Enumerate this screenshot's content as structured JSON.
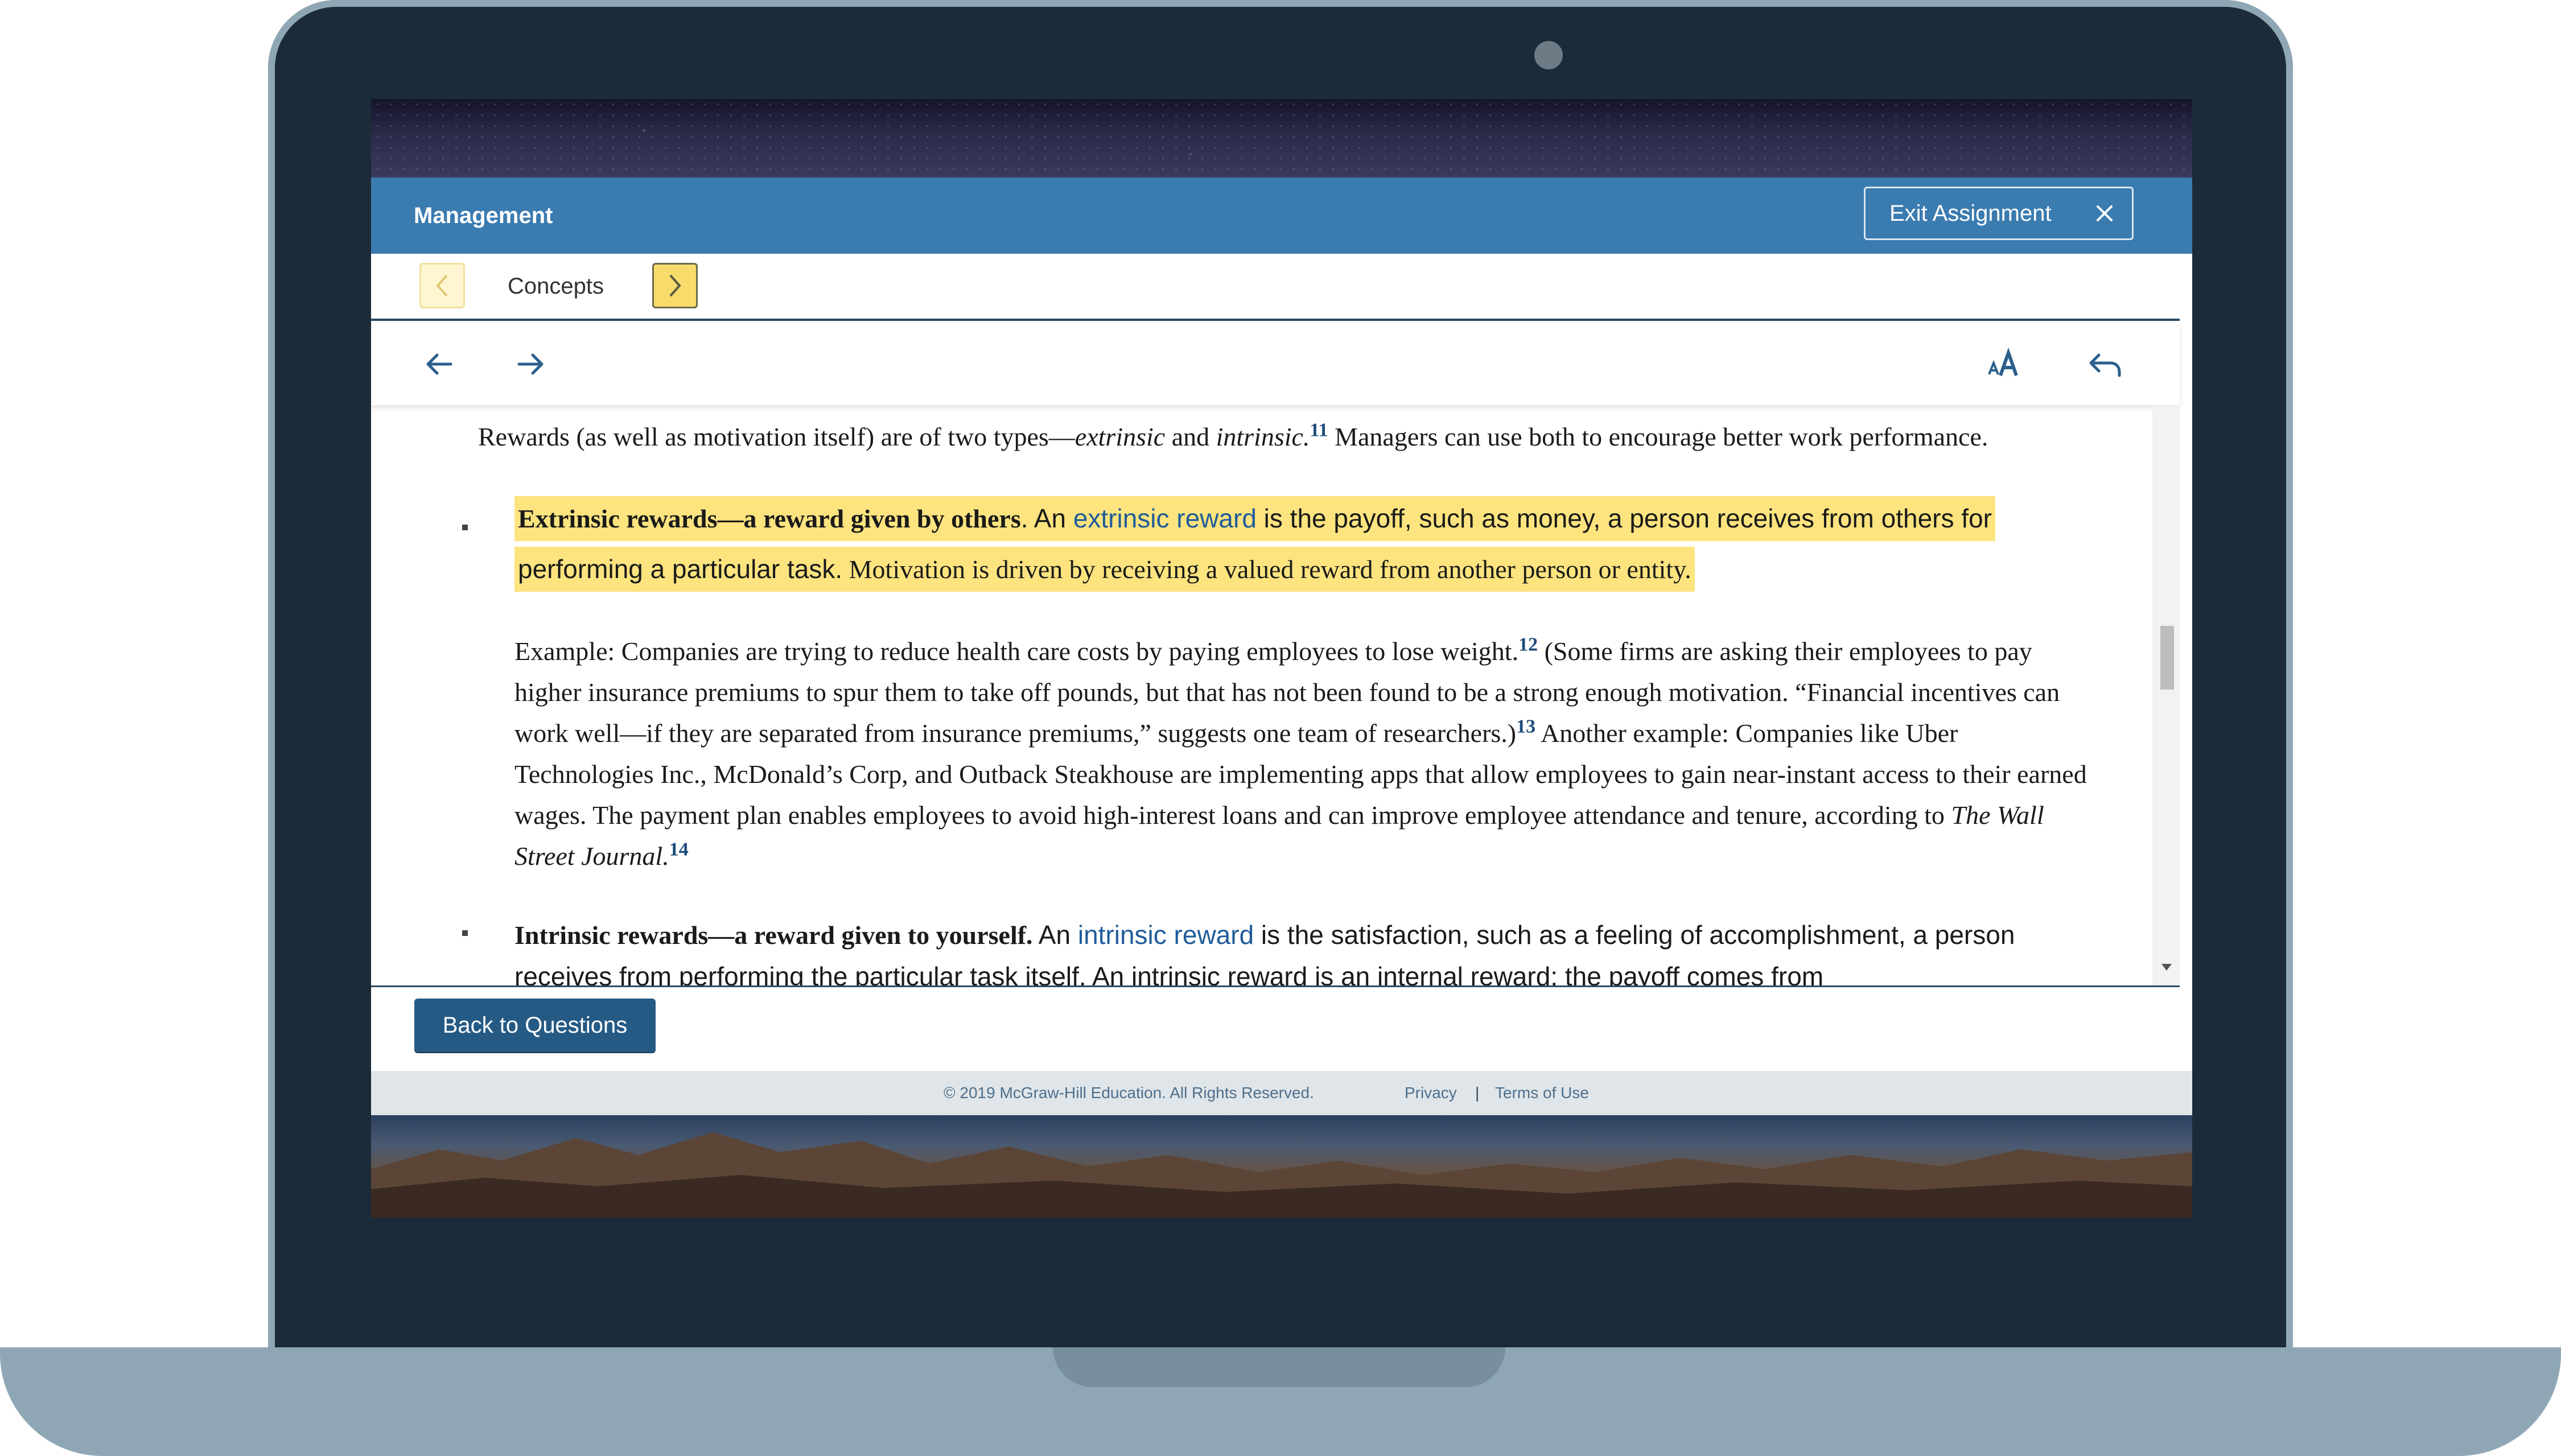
{
  "app": {
    "title": "Management"
  },
  "header": {
    "exit_label": "Exit Assignment",
    "exit_icon": "close-icon"
  },
  "concept_nav": {
    "label": "Concepts",
    "prev_icon": "chevron-left-icon",
    "next_icon": "chevron-right-icon"
  },
  "toolbar": {
    "back_icon": "arrow-left-icon",
    "forward_icon": "arrow-right-icon",
    "font_icon": "font-size-icon",
    "return_icon": "undo-icon"
  },
  "reading": {
    "intro_1": "Rewards (as well as motivation itself) are of two types—",
    "intro_extrinsic": "extrinsic",
    "intro_and": " and ",
    "intro_intrinsic": "intrinsic.",
    "intro_sup": "11",
    "intro_2": " Managers can use both to encourage better work performance.",
    "b1_bold": "Extrinsic rewards—a reward given by others",
    "b1_a": ". An ",
    "b1_link": "extrinsic reward",
    "b1_b": " is the payoff, such as money, a person receives from others for",
    "b1_c": "performing a particular task.",
    "b1_d": " Motivation is driven by receiving a valued reward from another person or entity.",
    "ex1_a": "Example: Companies are trying to reduce health care costs by paying employees to lose weight.",
    "ex1_sup1": "12",
    "ex1_b": " (Some firms are asking their employees to pay higher insurance premiums to spur them to take off pounds, but that has not been found to be a strong enough motivation. “Financial incentives can work well—if they are separated from insurance premiums,” suggests one team of researchers.)",
    "ex1_sup2": "13",
    "ex1_c": " Another example: Companies like Uber Technologies Inc., McDonald’s Corp, and Outback Steakhouse are implementing apps that allow employees to gain near-instant access to their earned wages. The payment plan enables employees to avoid high-interest loans and can improve employee attendance and tenure, according to ",
    "ex1_wsj": "The Wall Street Journal.",
    "ex1_sup3": "14",
    "b2_bold": "Intrinsic rewards—a reward given to yourself.",
    "b2_a": " An ",
    "b2_link": "intrinsic reward",
    "b2_b": " is the satisfaction, such as a feeling of accomplishment, a person receives from performing the particular task itself. An intrinsic reward is an internal reward; the payoff comes from"
  },
  "bottom": {
    "back_label": "Back to Questions"
  },
  "footer": {
    "copyright": "© 2019 McGraw-Hill Education. All Rights Reserved.",
    "privacy": "Privacy",
    "separator": "|",
    "terms": "Terms of Use"
  },
  "colors": {
    "appbar": "#3a7bb0",
    "highlight": "#fde47f",
    "button": "#255a85",
    "link": "#1f5c99",
    "frame": "#1b2b38"
  }
}
